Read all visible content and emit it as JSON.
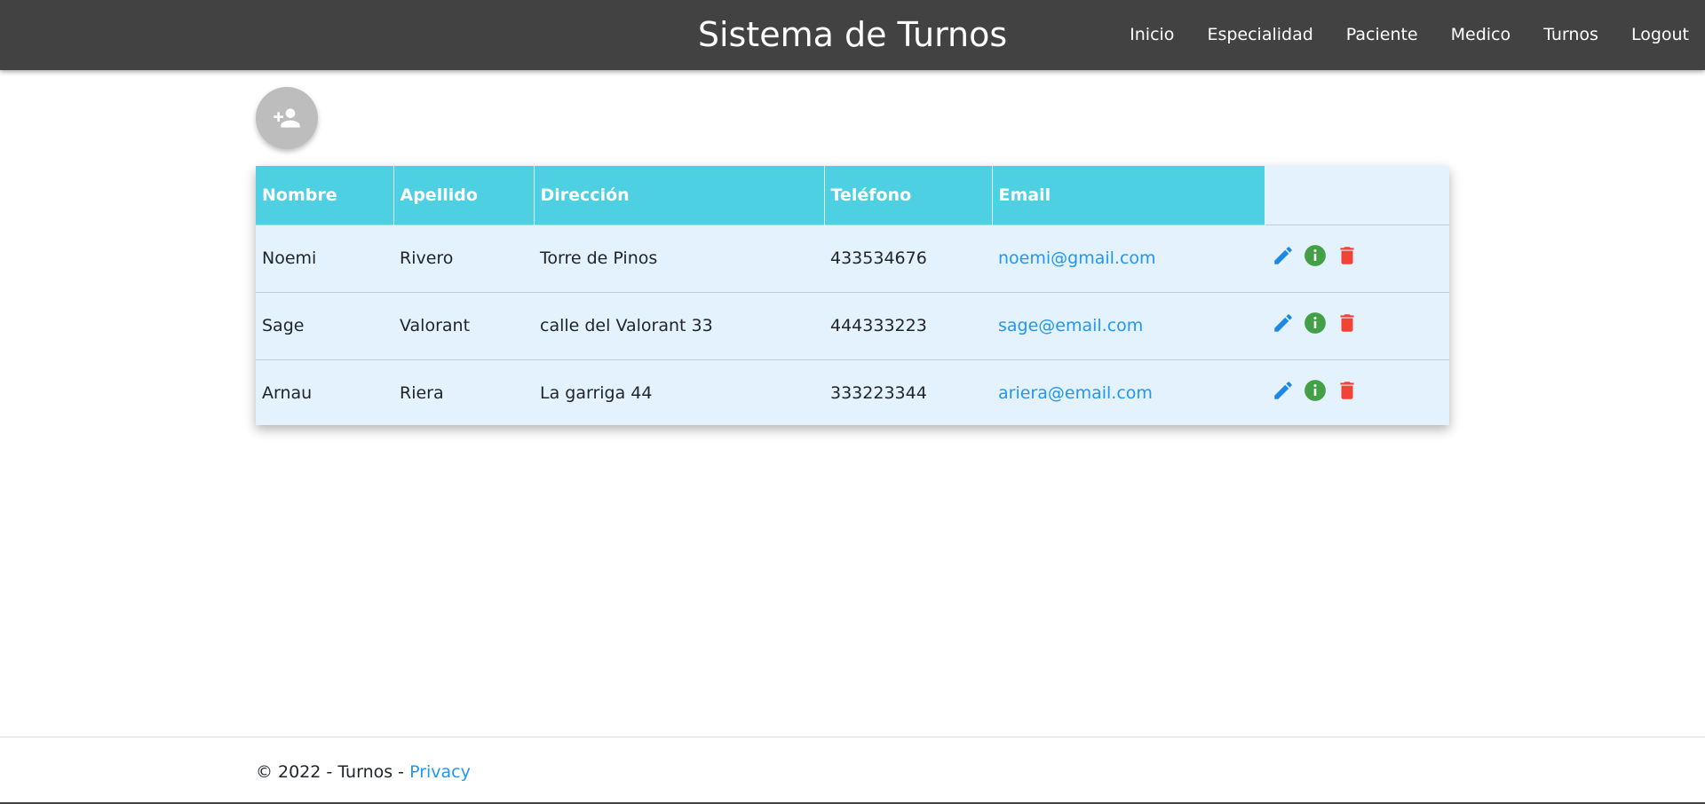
{
  "header": {
    "brand": "Sistema de Turnos",
    "nav": [
      "Inicio",
      "Especialidad",
      "Paciente",
      "Medico",
      "Turnos",
      "Logout"
    ]
  },
  "add_button": {
    "icon": "person-add-icon"
  },
  "table": {
    "headers": [
      "Nombre",
      "Apellido",
      "Dirección",
      "Teléfono",
      "Email"
    ],
    "rows": [
      {
        "nombre": "Noemi",
        "apellido": "Rivero",
        "direccion": "Torre de Pinos",
        "telefono": "433534676",
        "email": "noemi@gmail.com"
      },
      {
        "nombre": "Sage",
        "apellido": "Valorant",
        "direccion": "calle del Valorant 33",
        "telefono": "444333223",
        "email": "sage@email.com"
      },
      {
        "nombre": "Arnau",
        "apellido": "Riera",
        "direccion": "La garriga 44",
        "telefono": "333223344",
        "email": "ariera@email.com"
      }
    ],
    "action_icons": [
      "edit-icon",
      "info-icon",
      "delete-icon"
    ]
  },
  "footer": {
    "copyright": "© 2022 - Turnos - ",
    "privacy_link": "Privacy"
  },
  "colors": {
    "navbar": "#424242",
    "header_cell": "#4dd0e1",
    "table_bg": "#e3f2fd",
    "link": "#2196f3",
    "edit": "#1e88e5",
    "info": "#43a047",
    "delete": "#f44336",
    "add_button": "#bdbdbd"
  }
}
